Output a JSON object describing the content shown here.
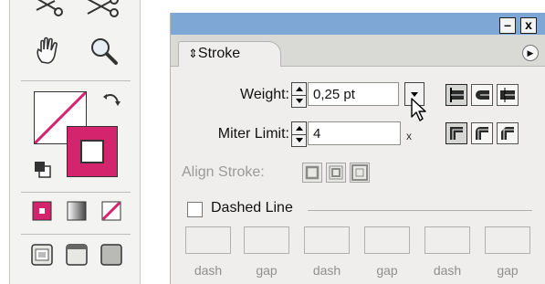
{
  "toolbox": {
    "tools": [
      {
        "name": "scissors-icon"
      },
      {
        "name": "knife-icon"
      },
      {
        "name": "hand-icon"
      },
      {
        "name": "zoom-icon"
      }
    ],
    "fill_stroke": {
      "fill": "none",
      "stroke_color": "#d4246e"
    },
    "color_mode_buttons": [
      "color-icon",
      "gradient-icon",
      "none-icon"
    ],
    "screen_mode_buttons": [
      "standard-screen-icon",
      "full-screen-menubar-icon",
      "full-screen-icon"
    ]
  },
  "palette": {
    "title_buttons": {
      "minimize": "–",
      "close": "x"
    },
    "tab_label": "Stroke",
    "tab_arrows": "⇕",
    "weight": {
      "label": "Weight:",
      "value": "0,25 pt"
    },
    "miter": {
      "label": "Miter Limit:",
      "value": "4",
      "suffix": "x"
    },
    "cap_buttons": [
      "butt-cap-icon",
      "round-cap-icon",
      "projecting-cap-icon"
    ],
    "join_buttons": [
      "miter-join-icon",
      "round-join-icon",
      "bevel-join-icon"
    ],
    "align_stroke": {
      "label": "Align Stroke:"
    },
    "dashed_line": {
      "label": "Dashed Line",
      "checked": false
    },
    "dash_labels": [
      "dash",
      "gap",
      "dash",
      "gap",
      "dash",
      "gap"
    ],
    "title_bar_color": "#7ea7d6",
    "accent_color": "#d4246e"
  }
}
